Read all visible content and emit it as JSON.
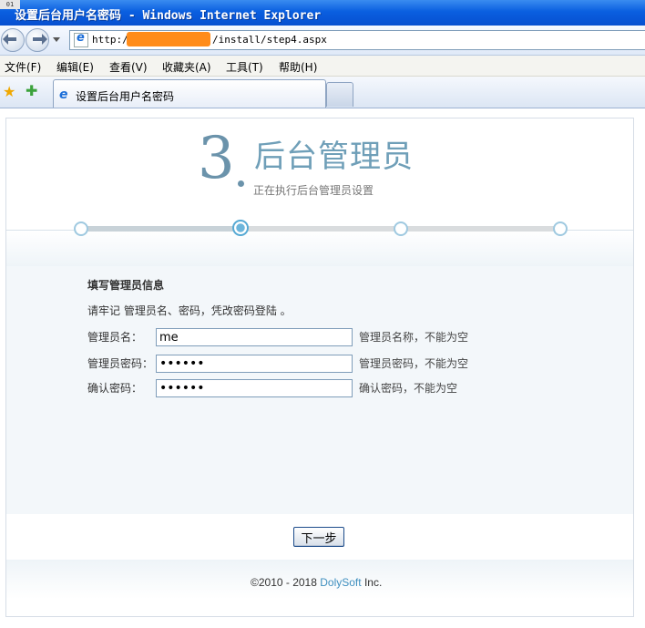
{
  "window": {
    "badge": "01",
    "title": "设置后台用户名密码 - Windows Internet Explorer"
  },
  "address": {
    "url_prefix": "http://",
    "url_suffix": "/install/step4.aspx"
  },
  "menu": {
    "items": [
      "文件(F)",
      "编辑(E)",
      "查看(V)",
      "收藏夹(A)",
      "工具(T)",
      "帮助(H)"
    ]
  },
  "tabs": {
    "active_label": "设置后台用户名密码"
  },
  "page": {
    "step_number": "3",
    "step_title": "后台管理员",
    "step_subtitle": "正在执行后台管理员设置",
    "progress": {
      "total_steps": 4,
      "current_step": 2
    },
    "form": {
      "section_title": "填写管理员信息",
      "hint": "请牢记 管理员名、密码，凭改密码登陆 。",
      "rows": [
        {
          "label": "管理员名：",
          "value": "me",
          "type": "text",
          "hint": "管理员名称，不能为空"
        },
        {
          "label": "管理员密码：",
          "value": "123456",
          "type": "password",
          "hint": "管理员密码，不能为空"
        },
        {
          "label": "确认密码：",
          "value": "123456",
          "type": "password",
          "hint": "确认密码，不能为空"
        }
      ]
    },
    "next_button": "下一步",
    "footer": {
      "copyright": "©2010 - 2018",
      "brand": "DolySoft",
      "suffix": "Inc."
    }
  },
  "colors": {
    "accent": "#6b93ab",
    "brand": "#3f8fbf",
    "titlebar": "#0a5fe0",
    "redaction": "#ff8c1a"
  }
}
